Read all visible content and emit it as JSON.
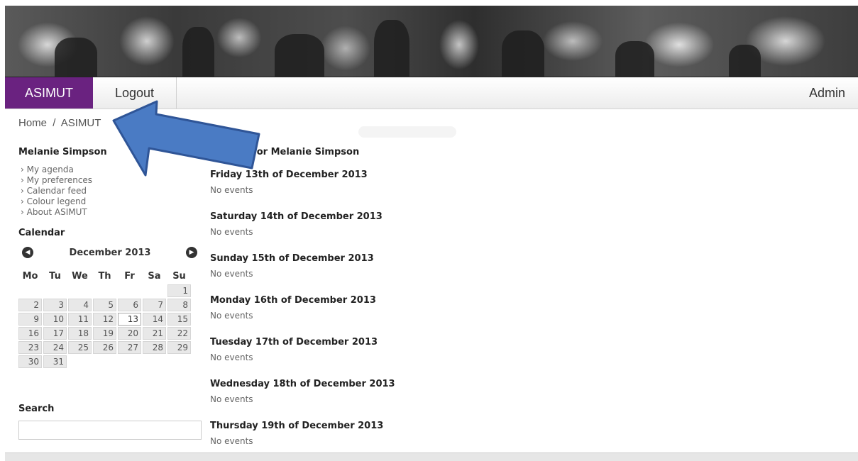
{
  "nav": {
    "asimut": "ASIMUT",
    "logout": "Logout",
    "admin": "Admin"
  },
  "breadcrumb": {
    "home": "Home",
    "separator": "/",
    "current": "ASIMUT"
  },
  "sidebar": {
    "user_name": "Melanie Simpson",
    "links": [
      "› My agenda",
      "› My preferences",
      "› Calendar feed",
      "› Colour legend",
      "› About ASIMUT"
    ],
    "calendar_title": "Calendar",
    "calendar": {
      "month": "December 2013",
      "weekdays": [
        "Mo",
        "Tu",
        "We",
        "Th",
        "Fr",
        "Sa",
        "Su"
      ],
      "weeks": [
        [
          "",
          "",
          "",
          "",
          "",
          "",
          "1"
        ],
        [
          "2",
          "3",
          "4",
          "5",
          "6",
          "7",
          "8"
        ],
        [
          "9",
          "10",
          "11",
          "12",
          "13",
          "14",
          "15"
        ],
        [
          "16",
          "17",
          "18",
          "19",
          "20",
          "21",
          "22"
        ],
        [
          "23",
          "24",
          "25",
          "26",
          "27",
          "28",
          "29"
        ],
        [
          "30",
          "31",
          "",
          "",
          "",
          "",
          ""
        ]
      ],
      "today": "13"
    },
    "search_title": "Search"
  },
  "agenda": {
    "title": "Agenda for Melanie Simpson",
    "days": [
      {
        "title": "Friday 13th of December 2013",
        "events": "No events"
      },
      {
        "title": "Saturday 14th of December 2013",
        "events": "No events"
      },
      {
        "title": "Sunday 15th of December 2013",
        "events": "No events"
      },
      {
        "title": "Monday 16th of December 2013",
        "events": "No events"
      },
      {
        "title": "Tuesday 17th of December 2013",
        "events": "No events"
      },
      {
        "title": "Wednesday 18th of December 2013",
        "events": "No events"
      },
      {
        "title": "Thursday 19th of December 2013",
        "events": "No events"
      }
    ]
  },
  "colors": {
    "brand_purple": "#6a2280",
    "arrow_fill": "#4a7bc4",
    "arrow_stroke": "#2f5597"
  },
  "icons": {
    "prev": "chevron-left-icon",
    "next": "chevron-right-icon"
  }
}
